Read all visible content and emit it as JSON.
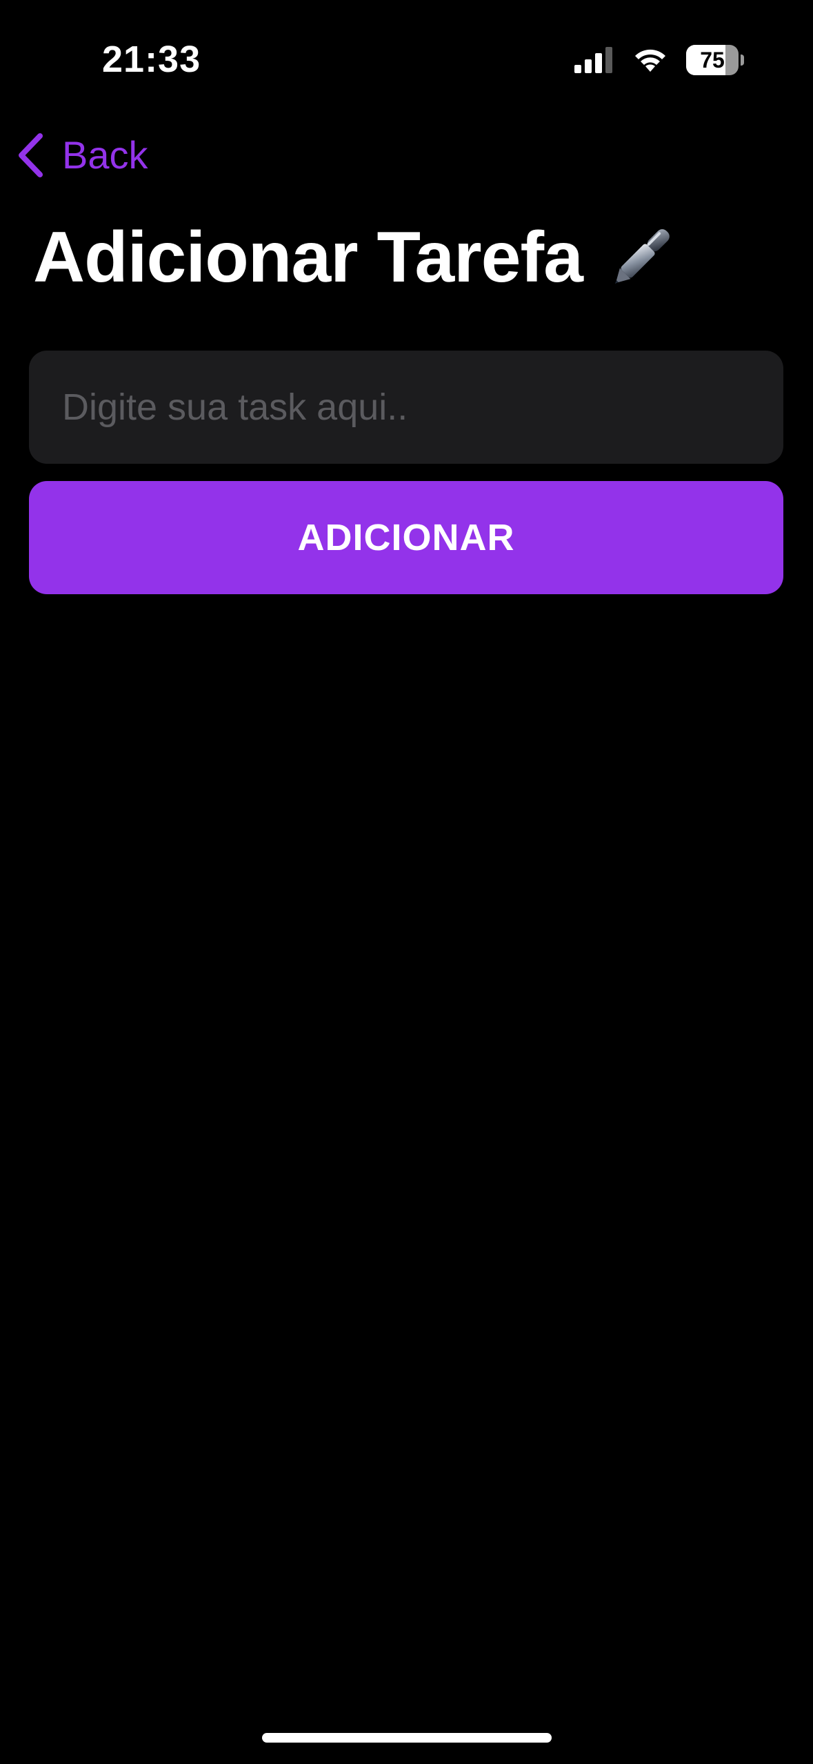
{
  "status_bar": {
    "time": "21:33",
    "battery_level": "75",
    "battery_fraction": 0.75,
    "icons": [
      "signal-icon",
      "wifi-icon",
      "battery-icon"
    ]
  },
  "nav": {
    "back_label": "Back",
    "back_icon": "chevron-left-icon"
  },
  "page": {
    "title": "Adicionar Tarefa",
    "title_icon": "pen-icon"
  },
  "form": {
    "task_input_value": "",
    "task_input_placeholder": "Digite sua task aqui..",
    "add_button_label": "ADICIONAR"
  },
  "colors": {
    "background": "#000000",
    "accent": "#9333ea",
    "input_background": "#1c1c1e",
    "placeholder": "#5b5b5f",
    "text": "#ffffff"
  }
}
